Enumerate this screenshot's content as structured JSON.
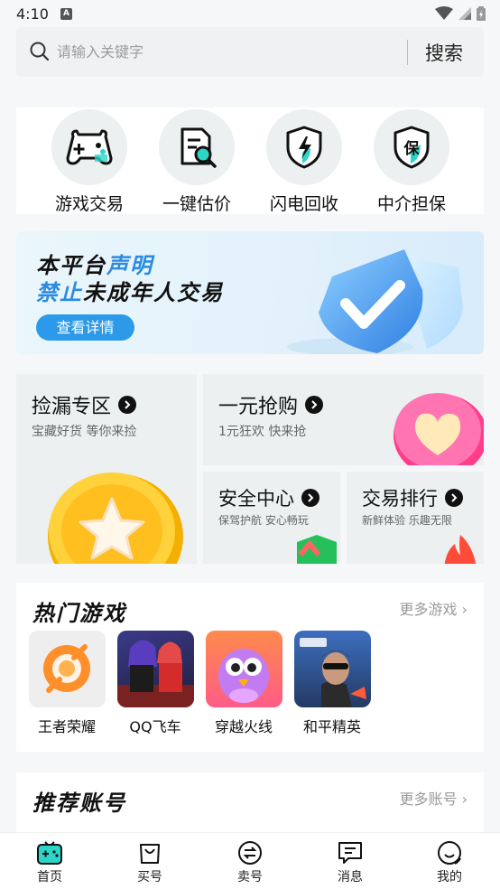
{
  "status": {
    "time": "4:10",
    "notification_letter": "A"
  },
  "search": {
    "placeholder": "请输入关键字",
    "button_label": "搜索"
  },
  "quick_actions": [
    {
      "label": "游戏交易",
      "icon": "gamepad-icon"
    },
    {
      "label": "一键估价",
      "icon": "appraisal-icon"
    },
    {
      "label": "闪电回收",
      "icon": "lightning-shield-icon"
    },
    {
      "label": "中介担保",
      "icon": "guarantee-shield-icon"
    }
  ],
  "banner": {
    "line1_prefix": "本平台",
    "line1_highlight": "声明",
    "line2_highlight": "禁止",
    "line2_rest": "未成年人交易",
    "cta": "查看详情"
  },
  "zones": {
    "bargain": {
      "title": "捡漏专区",
      "subtitle": "宝藏好货 等你来捡"
    },
    "flash": {
      "title": "一元抢购",
      "subtitle": "1元狂欢 快来抢"
    },
    "security": {
      "title": "安全中心",
      "subtitle": "保驾护航 安心畅玩"
    },
    "ranking": {
      "title": "交易排行",
      "subtitle": "新鲜体验 乐趣无限"
    }
  },
  "hot_games": {
    "title": "热门游戏",
    "more": "更多游戏 ›",
    "items": [
      {
        "name": "王者荣耀"
      },
      {
        "name": "QQ飞车"
      },
      {
        "name": "穿越火线"
      },
      {
        "name": "和平精英"
      }
    ]
  },
  "recommended": {
    "title": "推荐账号",
    "more": "更多账号 ›"
  },
  "tabbar": {
    "active_color": "#2bd6c8",
    "items": [
      {
        "label": "首页",
        "icon": "home-game-icon"
      },
      {
        "label": "买号",
        "icon": "shopping-bag-icon"
      },
      {
        "label": "卖号",
        "icon": "swap-icon"
      },
      {
        "label": "消息",
        "icon": "message-icon"
      },
      {
        "label": "我的",
        "icon": "profile-icon"
      }
    ]
  }
}
